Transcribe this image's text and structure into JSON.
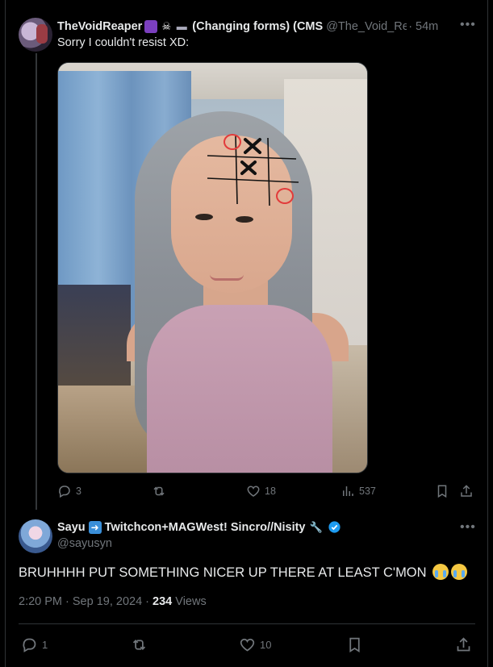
{
  "tweet1": {
    "display_name": "TheVoidReaper",
    "name_suffix": "(Changing forms) (CMS",
    "handle": "@The_Void_Rea",
    "time": "· 54m",
    "text": "Sorry I couldn't resist XD:",
    "stats": {
      "replies": "3",
      "likes": "18",
      "views": "537"
    }
  },
  "tweet2": {
    "display_name_part1": "Sayu",
    "display_name_part2": "Twitchcon+MAGWest! Sincro//Nisity",
    "handle": "@sayusyn",
    "text": "BRUHHHH PUT SOMETHING NICER UP THERE AT LEAST C'MON",
    "time": "2:20 PM · Sep 19, 2024 · ",
    "views_count": "234",
    "views_label": " Views",
    "stats": {
      "replies": "1",
      "likes": "10"
    }
  },
  "icons": [
    "more-icon",
    "reply-icon",
    "retweet-icon",
    "like-icon",
    "views-icon",
    "bookmark-icon",
    "share-icon",
    "verified-icon"
  ],
  "colors": {
    "background": "#000000",
    "text": "#e7e9ea",
    "muted": "#71767b",
    "verified": "#1d9bf0",
    "border": "#2f3336"
  }
}
